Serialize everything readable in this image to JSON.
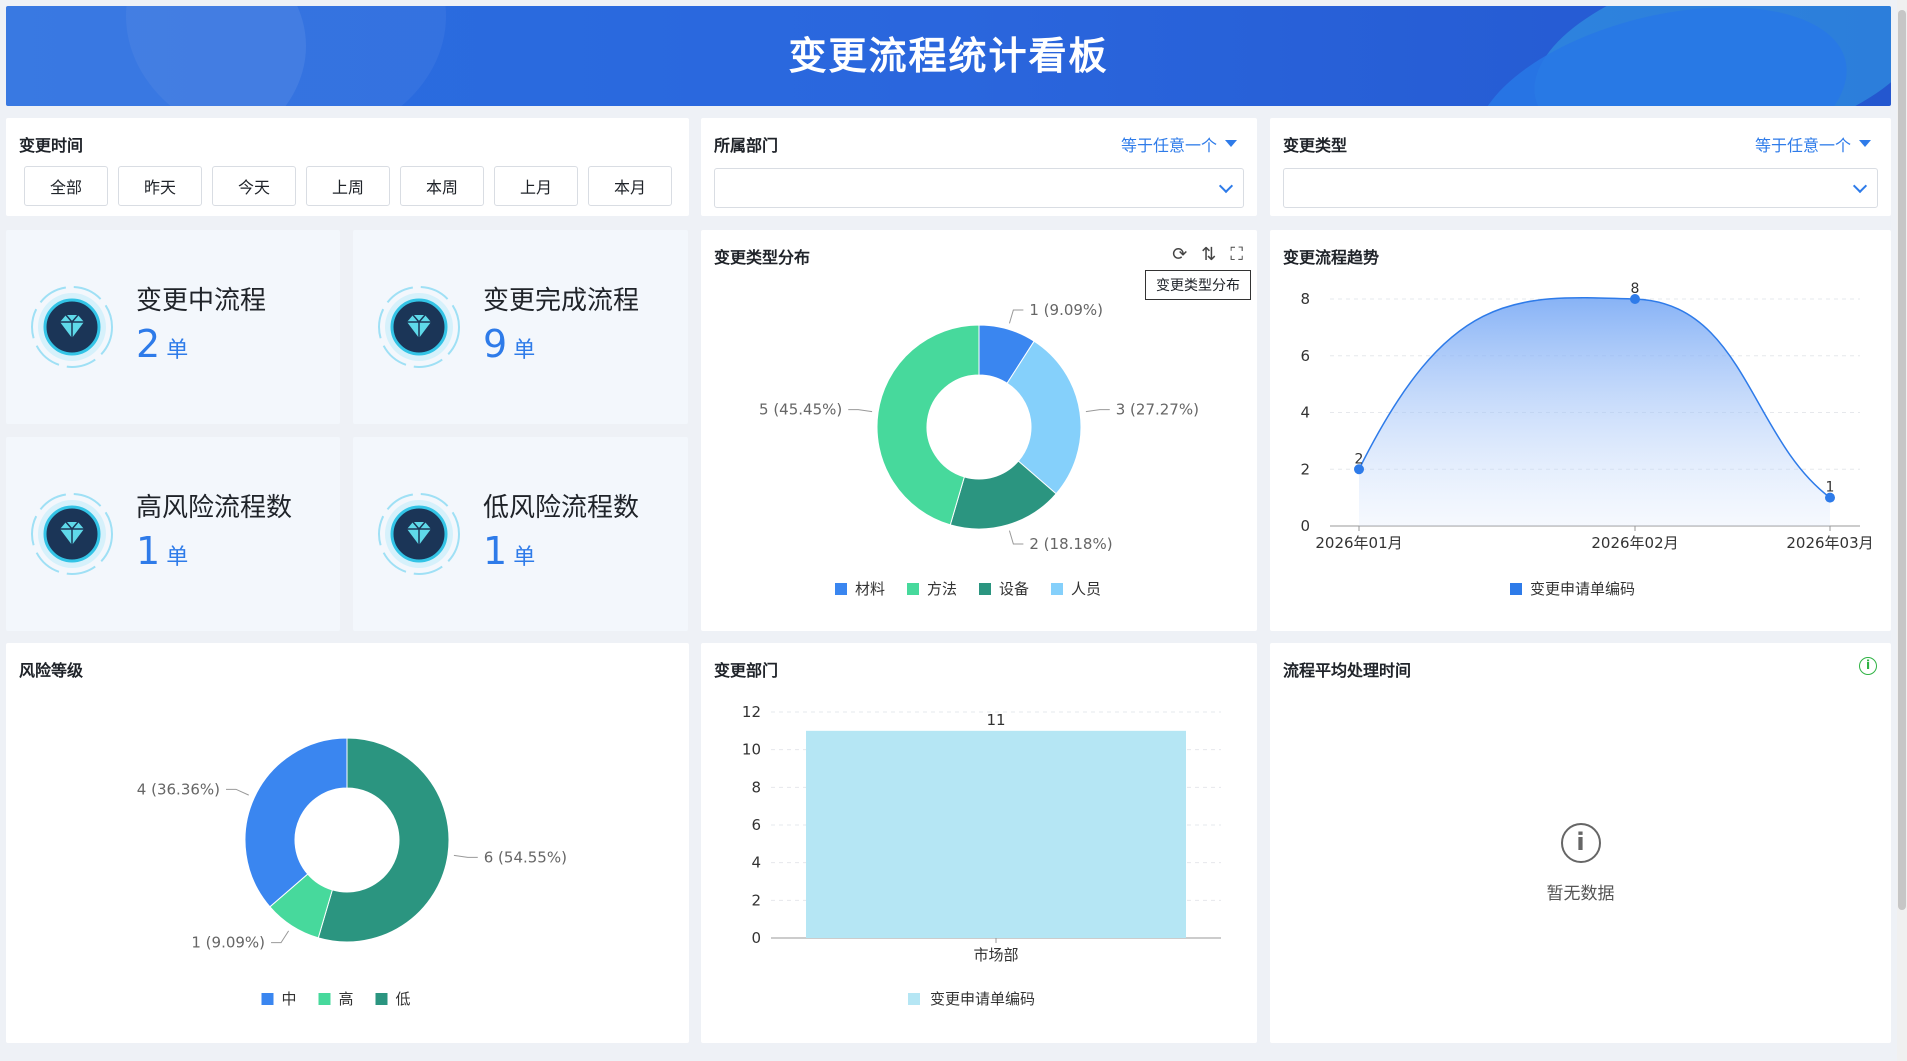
{
  "header": {
    "title": "变更流程统计看板"
  },
  "filters": {
    "time": {
      "label": "变更时间",
      "buttons": [
        "全部",
        "昨天",
        "今天",
        "上周",
        "本周",
        "上月",
        "本月"
      ]
    },
    "dept": {
      "label": "所属部门",
      "condition": "等于任意一个",
      "value": ""
    },
    "type": {
      "label": "变更类型",
      "condition": "等于任意一个",
      "value": ""
    }
  },
  "kpis": [
    {
      "label": "变更中流程",
      "value": "2",
      "unit": "单"
    },
    {
      "label": "变更完成流程",
      "value": "9",
      "unit": "单"
    },
    {
      "label": "高风险流程数",
      "value": "1",
      "unit": "单"
    },
    {
      "label": "低风险流程数",
      "value": "1",
      "unit": "单"
    }
  ],
  "typeDist": {
    "title": "变更类型分布",
    "tooltip": "变更类型分布"
  },
  "trend": {
    "title": "变更流程趋势"
  },
  "risk": {
    "title": "风险等级"
  },
  "dept": {
    "title": "变更部门"
  },
  "avgTime": {
    "title": "流程平均处理时间",
    "empty": "暂无数据"
  },
  "colors": {
    "blue": "#3a86f0",
    "green": "#47d99c",
    "teal": "#2b9580",
    "sky": "#85d0fb",
    "bar": "#b5e6f4",
    "accent": "#2e7be9"
  },
  "chart_data": [
    {
      "type": "pie",
      "title": "变更类型分布",
      "slices": [
        {
          "name": "材料",
          "value": 1,
          "label": "1 (9.09%)",
          "color": "#3a86f0"
        },
        {
          "name": "人员",
          "value": 3,
          "label": "3 (27.27%)",
          "color": "#85d0fb"
        },
        {
          "name": "设备",
          "value": 2,
          "label": "2 (18.18%)",
          "color": "#2b9580"
        },
        {
          "name": "方法",
          "value": 5,
          "label": "5 (45.45%)",
          "color": "#47d99c"
        }
      ],
      "legend": [
        "材料",
        "方法",
        "设备",
        "人员"
      ],
      "legend_position": "bottom"
    },
    {
      "type": "area",
      "title": "变更流程趋势",
      "categories": [
        "2026年01月",
        "2026年02月",
        "2026年03月"
      ],
      "series": [
        {
          "name": "变更申请单编码",
          "values": [
            2,
            8,
            1
          ]
        }
      ],
      "ylim": [
        0,
        8
      ],
      "yticks": [
        0,
        2,
        4,
        6,
        8
      ],
      "legend_position": "bottom"
    },
    {
      "type": "pie",
      "title": "风险等级",
      "slices": [
        {
          "name": "低",
          "value": 6,
          "label": "6 (54.55%)",
          "color": "#2b9580"
        },
        {
          "name": "高",
          "value": 1,
          "label": "1 (9.09%)",
          "color": "#47d99c"
        },
        {
          "name": "中",
          "value": 4,
          "label": "4 (36.36%)",
          "color": "#3a86f0"
        }
      ],
      "legend": [
        "中",
        "高",
        "低"
      ],
      "legend_position": "bottom"
    },
    {
      "type": "bar",
      "title": "变更部门",
      "categories": [
        "市场部"
      ],
      "series": [
        {
          "name": "变更申请单编码",
          "values": [
            11
          ]
        }
      ],
      "ylim": [
        0,
        12
      ],
      "yticks": [
        0,
        2,
        4,
        6,
        8,
        10,
        12
      ],
      "legend_position": "bottom"
    }
  ]
}
